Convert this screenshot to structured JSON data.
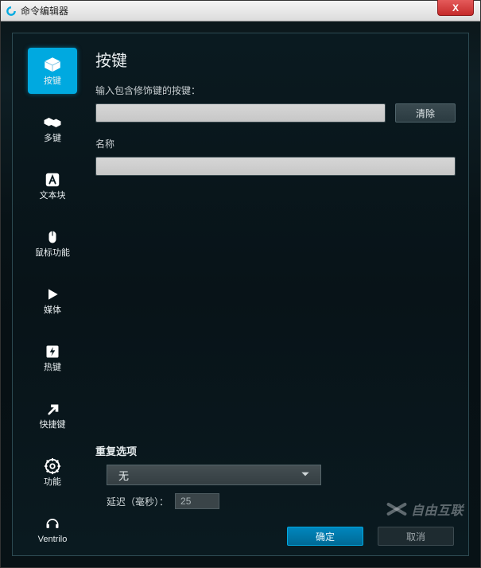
{
  "title": "命令编辑器",
  "close_glyph": "X",
  "sidebar": {
    "items": [
      {
        "label": "按键",
        "icon": "keycap"
      },
      {
        "label": "多键",
        "icon": "keys"
      },
      {
        "label": "文本块",
        "icon": "text"
      },
      {
        "label": "鼠标功能",
        "icon": "mouse"
      },
      {
        "label": "媒体",
        "icon": "play"
      },
      {
        "label": "热键",
        "icon": "bolt"
      },
      {
        "label": "快捷键",
        "icon": "arrow"
      },
      {
        "label": "功能",
        "icon": "gear"
      },
      {
        "label": "Ventrilo",
        "icon": "headset"
      }
    ]
  },
  "main": {
    "heading": "按键",
    "keystroke_label": "输入包含修饰键的按键：",
    "clear_label": "清除",
    "name_label": "名称",
    "keystroke_value": "",
    "name_value": ""
  },
  "repeat": {
    "title": "重复选项",
    "selected": "无",
    "delay_label": "延迟（毫秒）：",
    "delay_value": "25"
  },
  "footer": {
    "ok": "确定",
    "cancel": "取消"
  },
  "watermark": "自由互联",
  "colors": {
    "accent": "#00a9e0"
  }
}
